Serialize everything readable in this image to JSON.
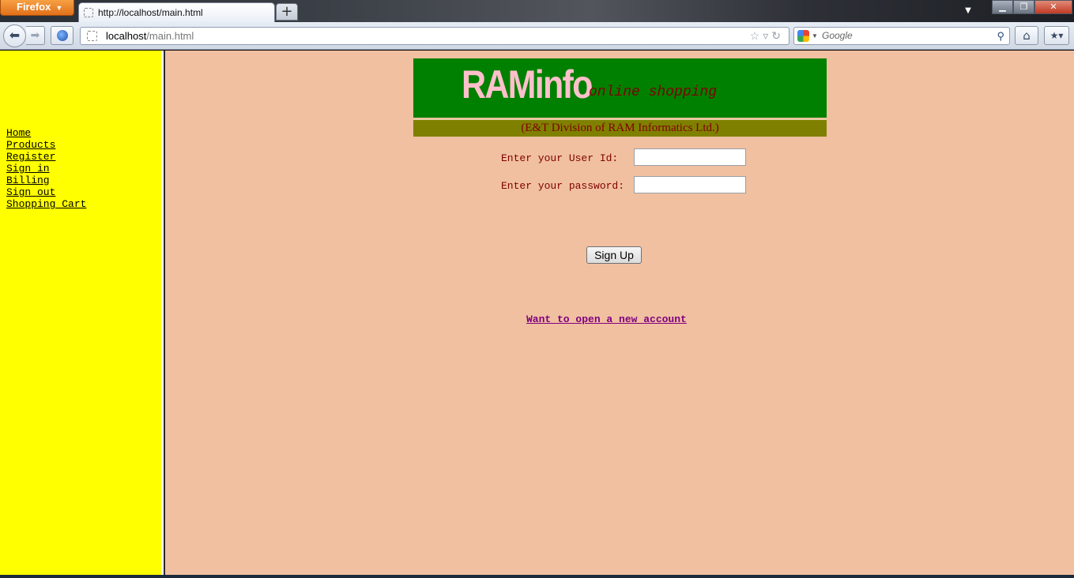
{
  "browser": {
    "menu_button": "Firefox",
    "tab_title": "http://localhost/main.html",
    "url_host": "localhost",
    "url_path": "/main.html",
    "search_placeholder": "Google"
  },
  "sidebar": {
    "links": [
      "Home",
      "Products",
      "Register",
      "Sign in",
      "Billing",
      "Sign out",
      "Shopping Cart"
    ]
  },
  "header": {
    "brand": "RAMinfo",
    "tagline": "online shopping",
    "subtitle": "(E&T Division of RAM Informatics Ltd.)"
  },
  "login_form": {
    "userid_label": "Enter your User Id:",
    "userid_value": "",
    "password_label": "Enter your password:",
    "password_value": "",
    "submit_label": "Sign Up"
  },
  "new_account_link": "Want to open a new account",
  "colors": {
    "sidebar_bg": "#ffff00",
    "page_bg": "#f0c0a0",
    "banner_bg": "#008000",
    "subtitle_bg": "#808000",
    "brand_text": "#ffc0cb",
    "label_text": "#800000",
    "link_visited": "#800080"
  }
}
